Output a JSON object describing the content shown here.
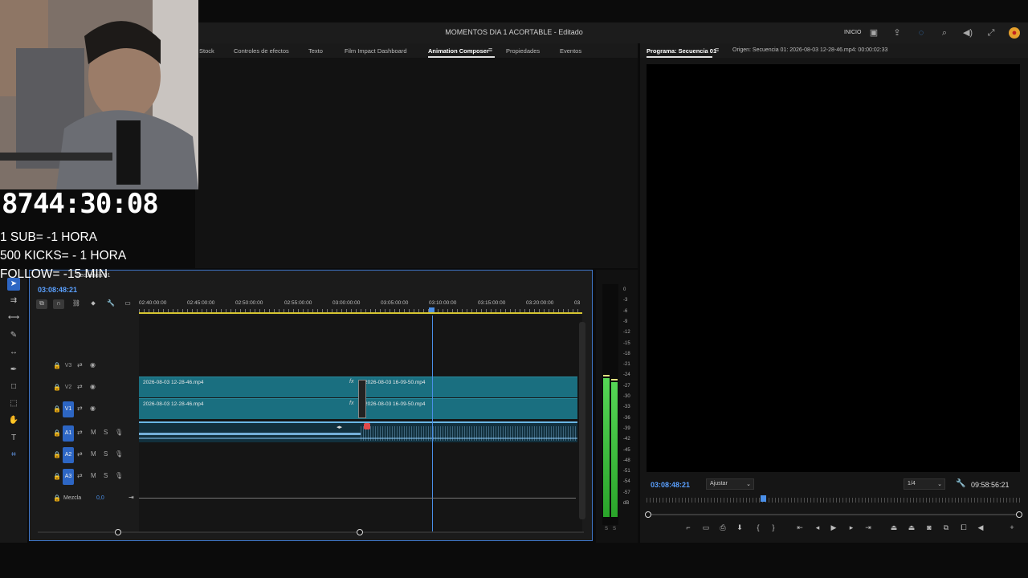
{
  "app": {
    "document_title": "MOMENTOS DIA 1 ACORTABLE - Editado",
    "home_label": "INICIO"
  },
  "upper_panel": {
    "tabs": [
      {
        "label": "Stock",
        "active": false
      },
      {
        "label": "Controles de efectos",
        "active": false
      },
      {
        "label": "Texto",
        "active": false
      },
      {
        "label": "Film Impact Dashboard",
        "active": false
      },
      {
        "label": "Animation Composer",
        "active": true
      },
      {
        "label": "Propiedades",
        "active": false
      },
      {
        "label": "Eventos",
        "active": false
      }
    ],
    "menu_glyph": "≡"
  },
  "program_panel": {
    "tab_program": "Programa: Secuencia 01",
    "tab_source": "Origen: Secuencia 01: 2026-08-03 12-28-46.mp4: 00:00:02:33",
    "timecode": "03:08:48:21",
    "fit": "Ajustar",
    "resolution": "1/4",
    "duration": "09:58:56:21"
  },
  "timeline": {
    "sequence_name": "Secuencia 01",
    "timecode": "03:08:48:21",
    "ruler_labels": [
      "02:40:00:00",
      "02:45:00:00",
      "02:50:00:00",
      "02:55:00:00",
      "03:00:00:00",
      "03:05:00:00",
      "03:10:00:00",
      "03:15:00:00",
      "03:20:00:00",
      "03"
    ],
    "video_tracks": [
      {
        "name": "V3",
        "targeted": false
      },
      {
        "name": "V2",
        "targeted": false
      },
      {
        "name": "V1",
        "targeted": true
      }
    ],
    "audio_tracks": [
      {
        "name": "A1",
        "targeted": true
      },
      {
        "name": "A2",
        "targeted": true
      },
      {
        "name": "A3",
        "targeted": true
      }
    ],
    "track_buttons": {
      "mute": "M",
      "solo": "S"
    },
    "clips": {
      "v2_first": "2026-08-03 12-28-46.mp4",
      "v2_second": "2026-08-03 16-09-50.mp4",
      "v1_first": "2026-08-03 12-28-46.mp4",
      "v1_second": "2026-08-03 16-09-50.mp4",
      "fx_badge": "fx"
    },
    "mix_label": "Mezcla",
    "mix_value": "0,0"
  },
  "meter": {
    "scale": [
      "0",
      "-3",
      "-6",
      "-9",
      "-12",
      "-15",
      "-18",
      "-21",
      "-24",
      "-27",
      "-30",
      "-33",
      "-36",
      "-39",
      "-42",
      "-45",
      "-48",
      "-51",
      "-54",
      "-57",
      "dB"
    ],
    "solo_labels": [
      "S",
      "S"
    ],
    "levels_db": [
      -21,
      -22
    ],
    "meter_color": "#4cc94c"
  },
  "overlay": {
    "counter": "8744:30:08",
    "lines": [
      "1 SUB= -1 HORA",
      "500 KICKS= - 1 HORA",
      "FOLLOW= -15 MIN"
    ]
  },
  "colors": {
    "accent": "#2d66c4",
    "timecode": "#5aa0ff",
    "clip_video": "#1a6f80",
    "clip_audio_wave": "#8fd0ff",
    "work_area": "#d6c631"
  }
}
